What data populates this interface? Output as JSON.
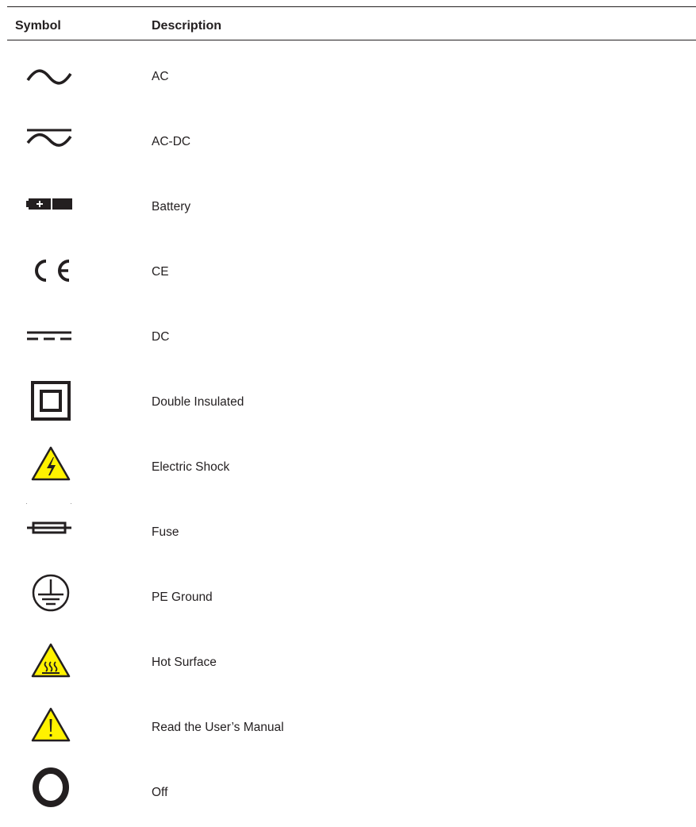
{
  "table": {
    "header": {
      "symbol": "Symbol",
      "description": "Description"
    },
    "rows": [
      {
        "icon": "ac-wave-icon",
        "description": "AC"
      },
      {
        "icon": "ac-dc-icon",
        "description": "AC-DC"
      },
      {
        "icon": "battery-icon",
        "description": "Battery"
      },
      {
        "icon": "ce-mark-icon",
        "description": "CE"
      },
      {
        "icon": "dc-icon",
        "description": "DC"
      },
      {
        "icon": "double-insulated-icon",
        "description": "Double Insulated"
      },
      {
        "icon": "electric-shock-warning-icon",
        "description": "Electric Shock"
      },
      {
        "icon": "fuse-icon",
        "description": "Fuse"
      },
      {
        "icon": "pe-ground-icon",
        "description": "PE Ground"
      },
      {
        "icon": "hot-surface-warning-icon",
        "description": "Hot Surface"
      },
      {
        "icon": "caution-warning-icon",
        "description": "Read the User’s Manual"
      },
      {
        "icon": "off-circle-icon",
        "description": "Off"
      }
    ]
  },
  "colors": {
    "ink": "#231f20",
    "warning_yellow": "#fff200"
  }
}
